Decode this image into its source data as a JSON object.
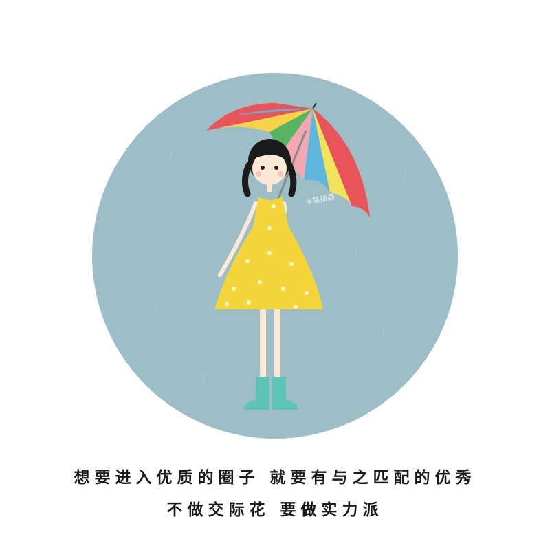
{
  "illustration": {
    "subject": "girl-with-rainbow-umbrella",
    "signature": "※某插画",
    "colors": {
      "circle": "#9dbdc7",
      "dress": "#f5d63a",
      "boots": "#5ec4b8",
      "hair": "#1b1b1b",
      "skin": "#fbe9d6",
      "umbrella": [
        "#e8545a",
        "#f7d34a",
        "#5fb6dd",
        "#57b463",
        "#f3a7b1",
        "#f0e35a"
      ]
    }
  },
  "caption": {
    "line1": "想要进入优质的圈子 就要有与之匹配的优秀",
    "line2": "不做交际花 要做实力派"
  }
}
